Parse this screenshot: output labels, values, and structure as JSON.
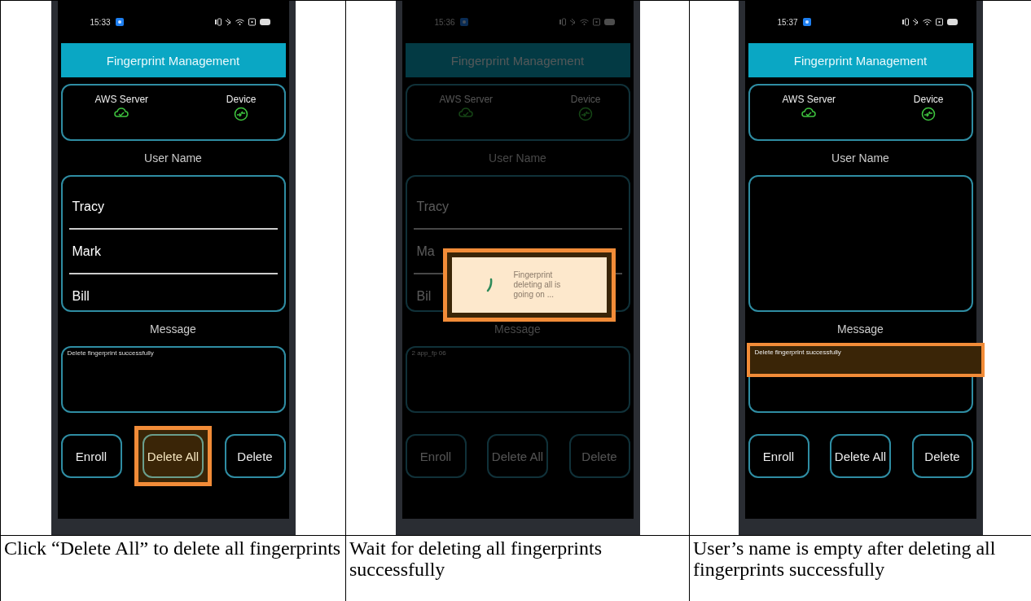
{
  "panels": [
    {
      "time": "15:33",
      "title": "Fingerprint Management",
      "server_label": "AWS Server",
      "device_label": "Device",
      "user_name_label": "User Name",
      "users": [
        "Tracy",
        "Mark",
        "Bill"
      ],
      "message_label": "Message",
      "message": "Delete fingerprint successfully",
      "message_highlighted": false,
      "dimmed": false,
      "buttons": [
        {
          "label": "Enroll",
          "highlighted": false
        },
        {
          "label": "Delete All",
          "highlighted": true
        },
        {
          "label": "Delete",
          "highlighted": false
        }
      ],
      "caption": "Click “Delete All” to delete all fingerprints"
    },
    {
      "time": "15:36",
      "title": "Fingerprint Management",
      "server_label": "AWS Server",
      "device_label": "Device",
      "user_name_label": "User Name",
      "users": [
        "Tracy",
        "Ma",
        "Bil"
      ],
      "message_label": "Message",
      "message": "2 app_fp 06",
      "message_highlighted": false,
      "dimmed": true,
      "dialog": {
        "text": "Fingerprint deleting all is going on ..."
      },
      "buttons": [
        {
          "label": "Enroll",
          "highlighted": false
        },
        {
          "label": "Delete All",
          "highlighted": false
        },
        {
          "label": "Delete",
          "highlighted": false
        }
      ],
      "caption": "Wait for deleting all fingerprints successfully"
    },
    {
      "time": "15:37",
      "title": "Fingerprint Management",
      "server_label": "AWS Server",
      "device_label": "Device",
      "user_name_label": "User Name",
      "message_label": "Message",
      "message": "Delete fingerprint successfully",
      "message_highlighted": true,
      "dimmed": false,
      "buttons": [
        {
          "label": "Enroll",
          "highlighted": false
        },
        {
          "label": "Delete All",
          "highlighted": false
        },
        {
          "label": "Delete",
          "highlighted": false
        }
      ],
      "caption": "User’s name is empty after deleting all fingerprints successfully"
    }
  ]
}
